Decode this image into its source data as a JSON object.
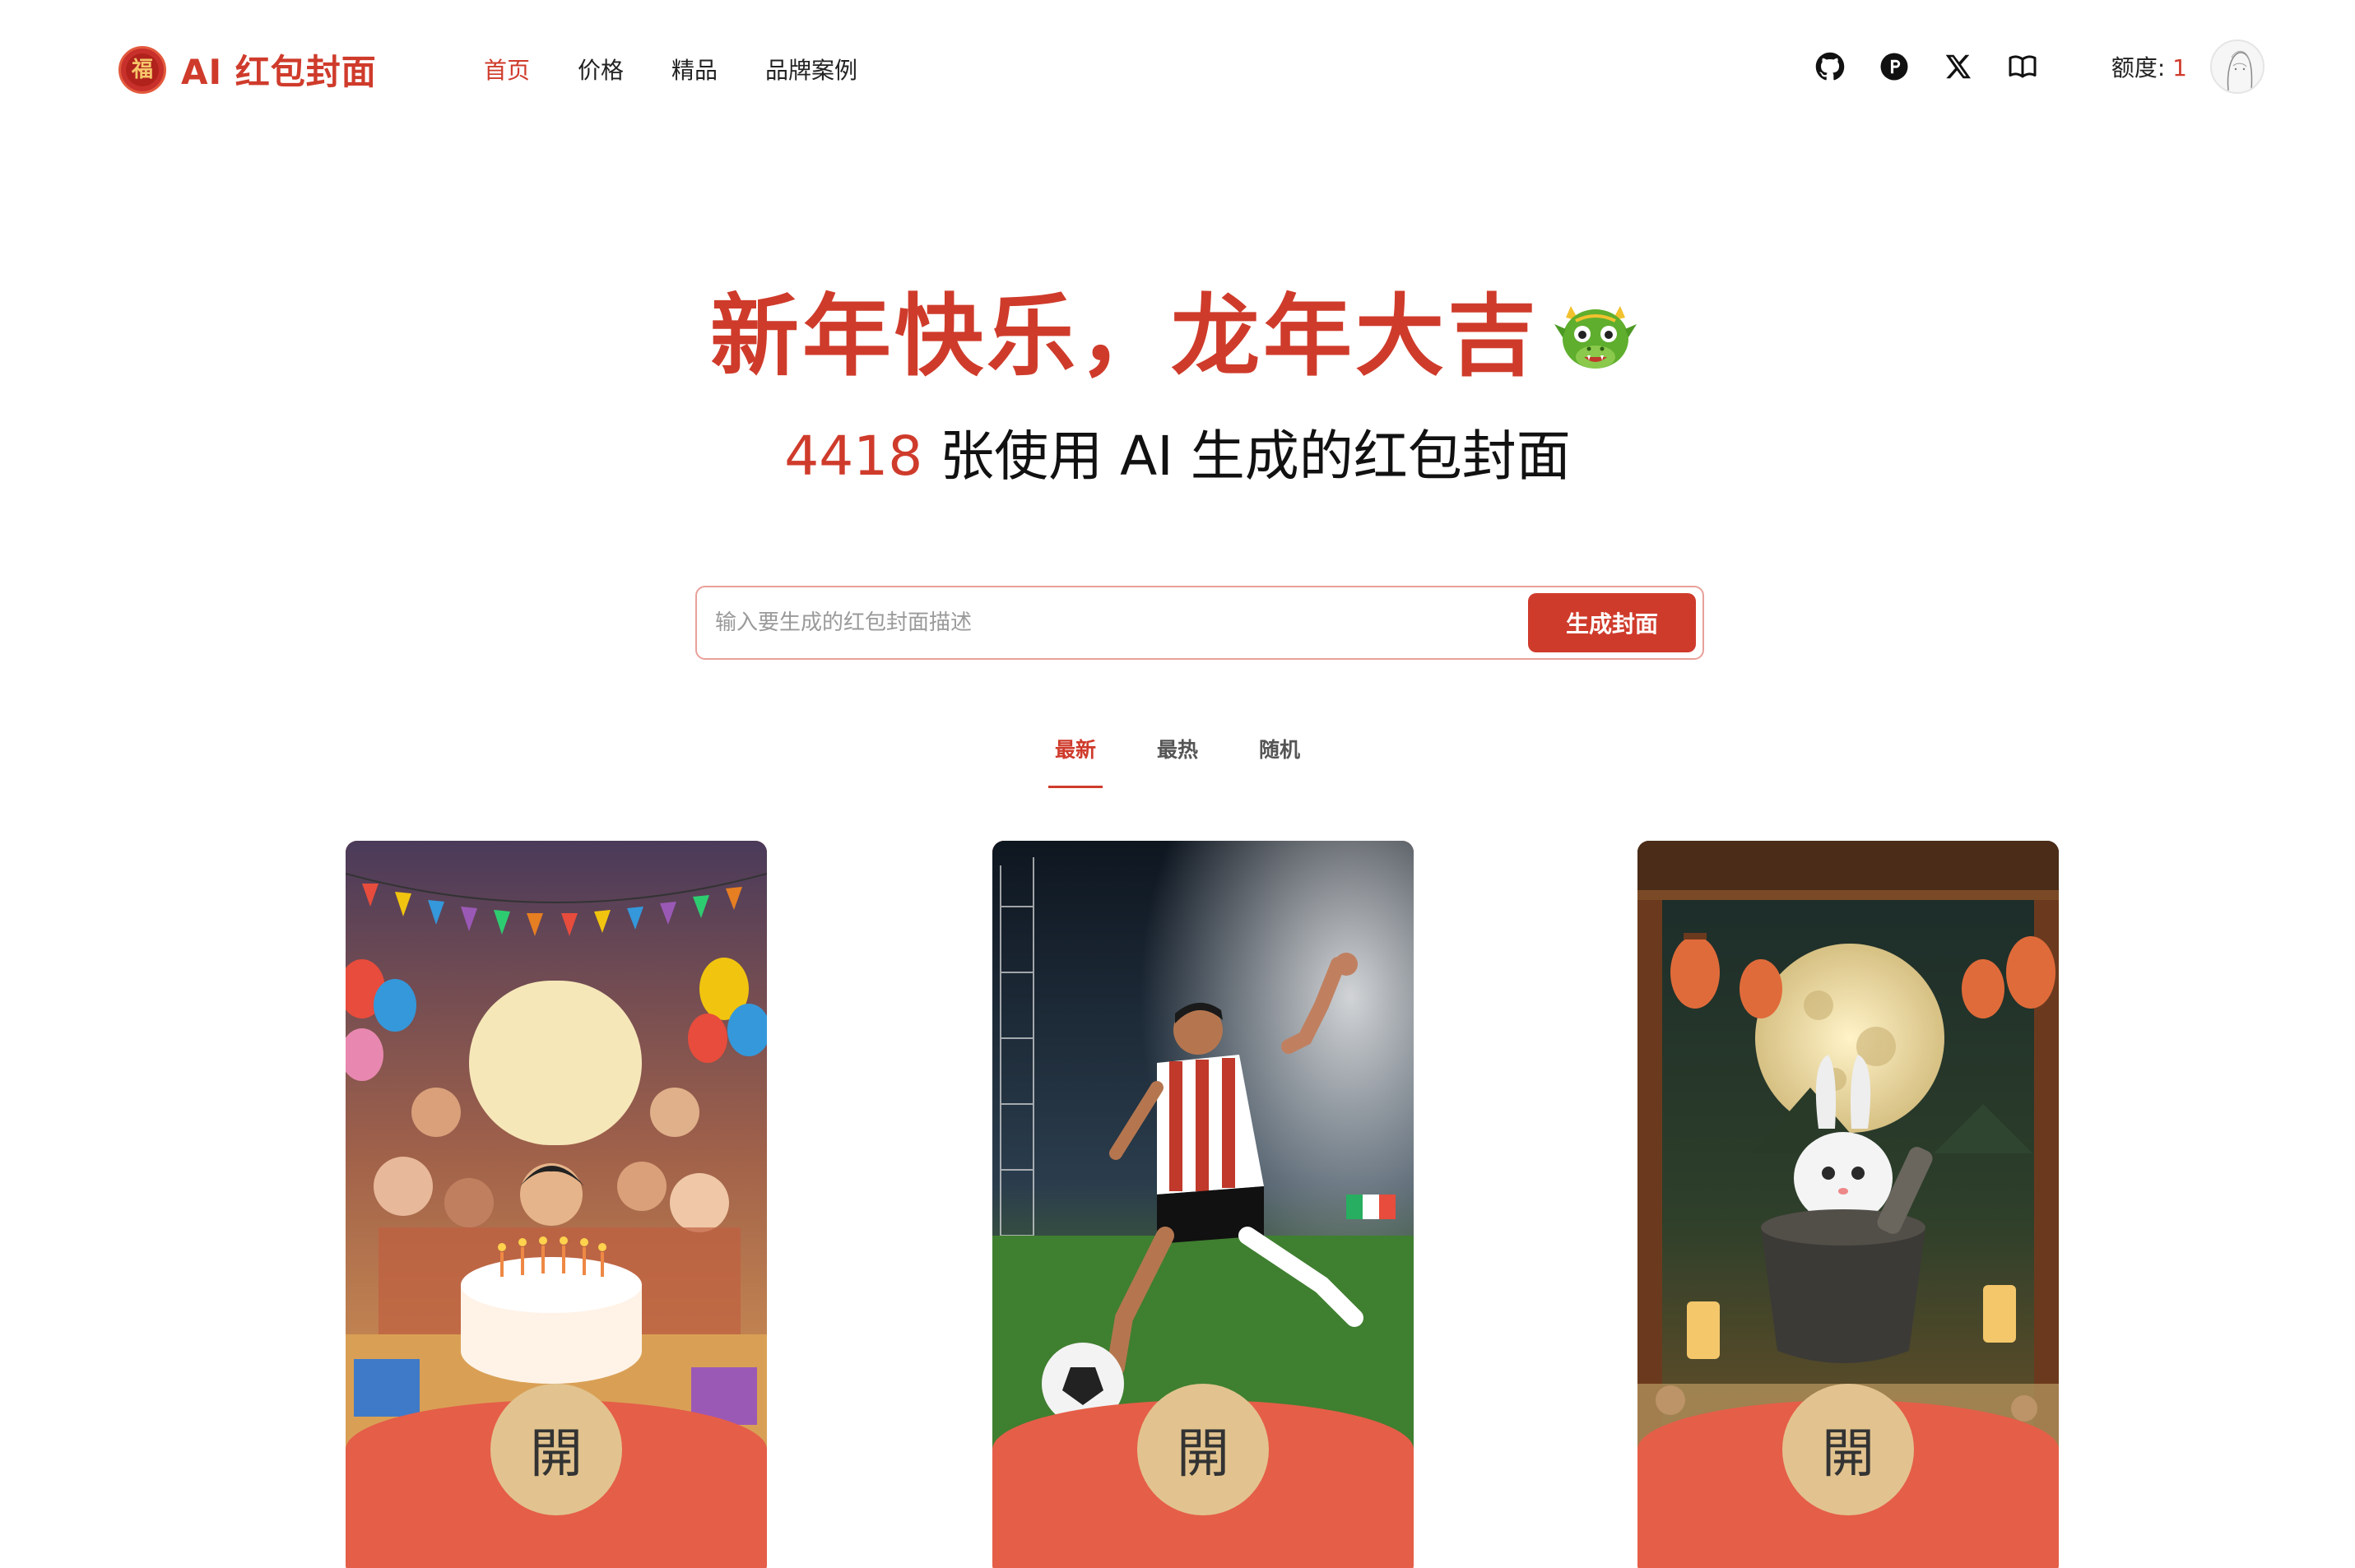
{
  "header": {
    "brand_logo_char": "福",
    "brand_name": "AI 红包封面",
    "nav": [
      "首页",
      "价格",
      "精品",
      "品牌案例"
    ],
    "nav_active_index": 0,
    "icons": [
      "github-icon",
      "producthunt-icon",
      "x-icon",
      "book-icon"
    ],
    "quota_label": "额度:",
    "quota_value": "1"
  },
  "hero": {
    "title": "新年快乐，龙年大吉",
    "title_emoji": "dragon-icon",
    "count": "4418",
    "subtitle_rest": " 张使用 AI 生成的红包封面"
  },
  "search": {
    "placeholder": "输入要生成的红包封面描述",
    "value": "",
    "button_label": "生成封面"
  },
  "tabs": [
    "最新",
    "最热",
    "随机"
  ],
  "tabs_active_index": 0,
  "cards": [
    {
      "scene": "birthday-party",
      "open_label": "開"
    },
    {
      "scene": "soccer-player",
      "open_label": "開"
    },
    {
      "scene": "moon-rabbit",
      "open_label": "開"
    }
  ],
  "colors": {
    "brand_red": "#cf3b2b",
    "envelope_red": "#e55e48",
    "open_button_gold": "#e2c38f"
  }
}
